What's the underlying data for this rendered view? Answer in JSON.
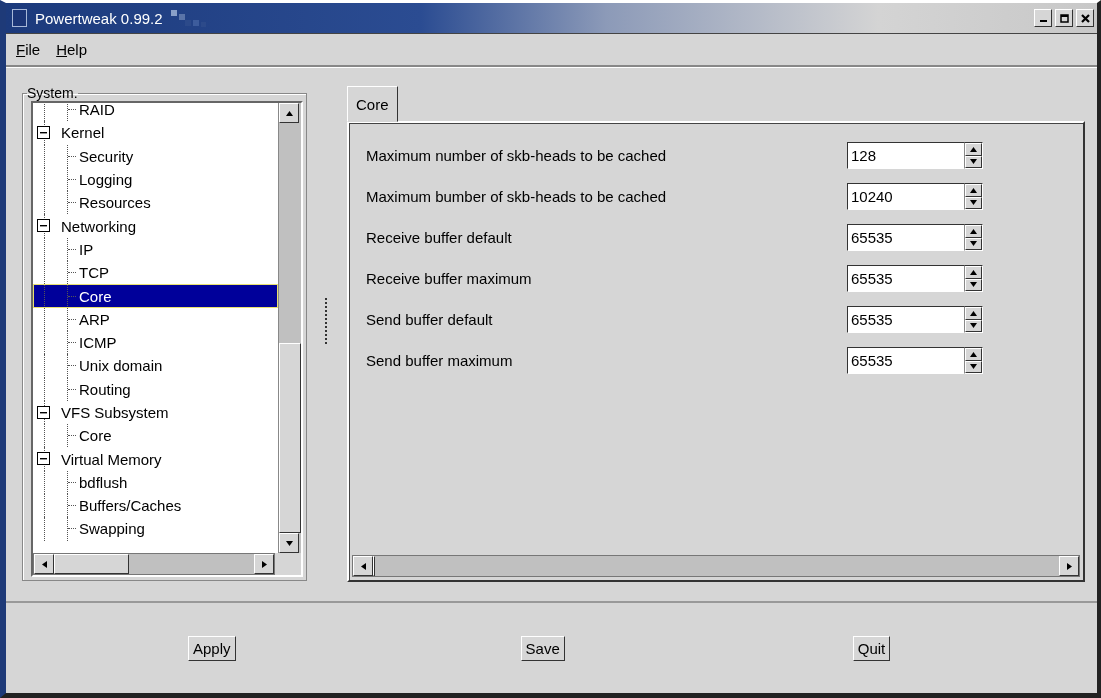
{
  "window": {
    "title": "Powertweak 0.99.2"
  },
  "menu": [
    {
      "label": "File"
    },
    {
      "label": "Help"
    }
  ],
  "tree": {
    "title": "System.",
    "items": [
      {
        "children": [
          {
            "label": "RAID",
            "selected": false
          }
        ]
      },
      {
        "label": "Kernel",
        "selected": false,
        "expanded": true,
        "children": [
          {
            "label": "Security",
            "selected": false
          },
          {
            "label": "Logging",
            "selected": false
          },
          {
            "label": "Resources",
            "selected": false
          }
        ]
      },
      {
        "label": "Networking",
        "selected": false,
        "expanded": true,
        "children": [
          {
            "label": "IP",
            "selected": false
          },
          {
            "label": "TCP",
            "selected": false
          },
          {
            "label": "Core",
            "selected": true
          },
          {
            "label": "ARP",
            "selected": false
          },
          {
            "label": "ICMP",
            "selected": false
          },
          {
            "label": "Unix domain",
            "selected": false
          },
          {
            "label": "Routing",
            "selected": false
          }
        ]
      },
      {
        "label": "VFS Subsystem",
        "selected": false,
        "expanded": true,
        "children": [
          {
            "label": "Core",
            "selected": false
          }
        ]
      },
      {
        "label": "Virtual Memory",
        "selected": false,
        "expanded": true,
        "children": [
          {
            "label": "bdflush",
            "selected": false
          },
          {
            "label": "Buffers/Caches",
            "selected": false
          },
          {
            "label": "Swapping",
            "selected": false
          }
        ]
      }
    ]
  },
  "tabs": [
    {
      "label": "Core",
      "selected": true
    }
  ],
  "settings": [
    {
      "label": "Maximum number of skb-heads to be cached",
      "value": "128"
    },
    {
      "label": "Maximum bumber of skb-heads to be cached",
      "value": "10240"
    },
    {
      "label": "Receive buffer default",
      "value": "65535"
    },
    {
      "label": "Receive buffer maximum",
      "value": "65535"
    },
    {
      "label": "Send buffer default",
      "value": "65535"
    },
    {
      "label": "Send buffer maximum",
      "value": "65535"
    }
  ],
  "buttons": [
    {
      "label": "Apply"
    },
    {
      "label": "Save"
    },
    {
      "label": "Quit"
    }
  ]
}
